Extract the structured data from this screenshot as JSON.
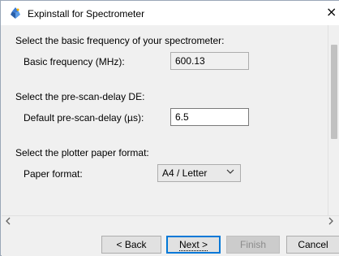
{
  "window": {
    "title": "Expinstall for Spectrometer",
    "close_glyph": "×"
  },
  "basic_frequency": {
    "section": "Select the basic frequency of your spectrometer:",
    "label": "Basic frequency (MHz):",
    "value": "600.13"
  },
  "pre_scan_delay": {
    "section": "Select the pre-scan-delay DE:",
    "label": "Default pre-scan-delay (µs):",
    "value": "6.5"
  },
  "paper_format": {
    "section": "Select the plotter paper format:",
    "label": "Paper format:",
    "selected": "A4 / Letter"
  },
  "buttons": {
    "back": "< Back",
    "next": "Next >",
    "finish": "Finish",
    "cancel": "Cancel"
  },
  "icons": {
    "title": "spectrometer-app-icon",
    "close": "close-icon",
    "dropdown": "chevron-down-icon",
    "scroll_left": "scroll-left-arrow-icon",
    "scroll_right": "scroll-right-arrow-icon"
  },
  "colors": {
    "default_button_border": "#0078d7",
    "window_background": "#f0f0f0",
    "disabled_text": "#8c8c8c"
  }
}
